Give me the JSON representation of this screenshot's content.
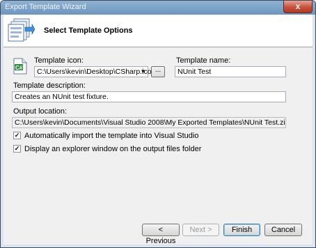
{
  "window": {
    "title": "Export Template Wizard",
    "close_glyph": "x"
  },
  "header": {
    "title": "Select Template Options",
    "icon": "export-template-wizard-icon"
  },
  "template_icon": {
    "label": "Template icon:",
    "value": "C:\\Users\\kevin\\Desktop\\CSharp.ico",
    "browse_label": "...",
    "preview_icon": "csharp-file-icon",
    "preview_text": "C#"
  },
  "template_name": {
    "label": "Template name:",
    "value": "NUnit Test"
  },
  "template_description": {
    "label": "Template description:",
    "value": "Creates an NUnit test fixture."
  },
  "output_location": {
    "label": "Output location:",
    "value": "C:\\Users\\kevin\\Documents\\Visual Studio 2008\\My Exported Templates\\NUnit Test.zip"
  },
  "options": [
    {
      "label": "Automatically import the template into Visual Studio",
      "checked": true
    },
    {
      "label": "Display an explorer window on the output files folder",
      "checked": true
    }
  ],
  "buttons": {
    "previous": "< Previous",
    "next": "Next >",
    "finish": "Finish",
    "cancel": "Cancel"
  },
  "colors": {
    "titlebar": "#7aa1c9",
    "close": "#c6503a",
    "dialog_bg": "#f0f0f0"
  }
}
